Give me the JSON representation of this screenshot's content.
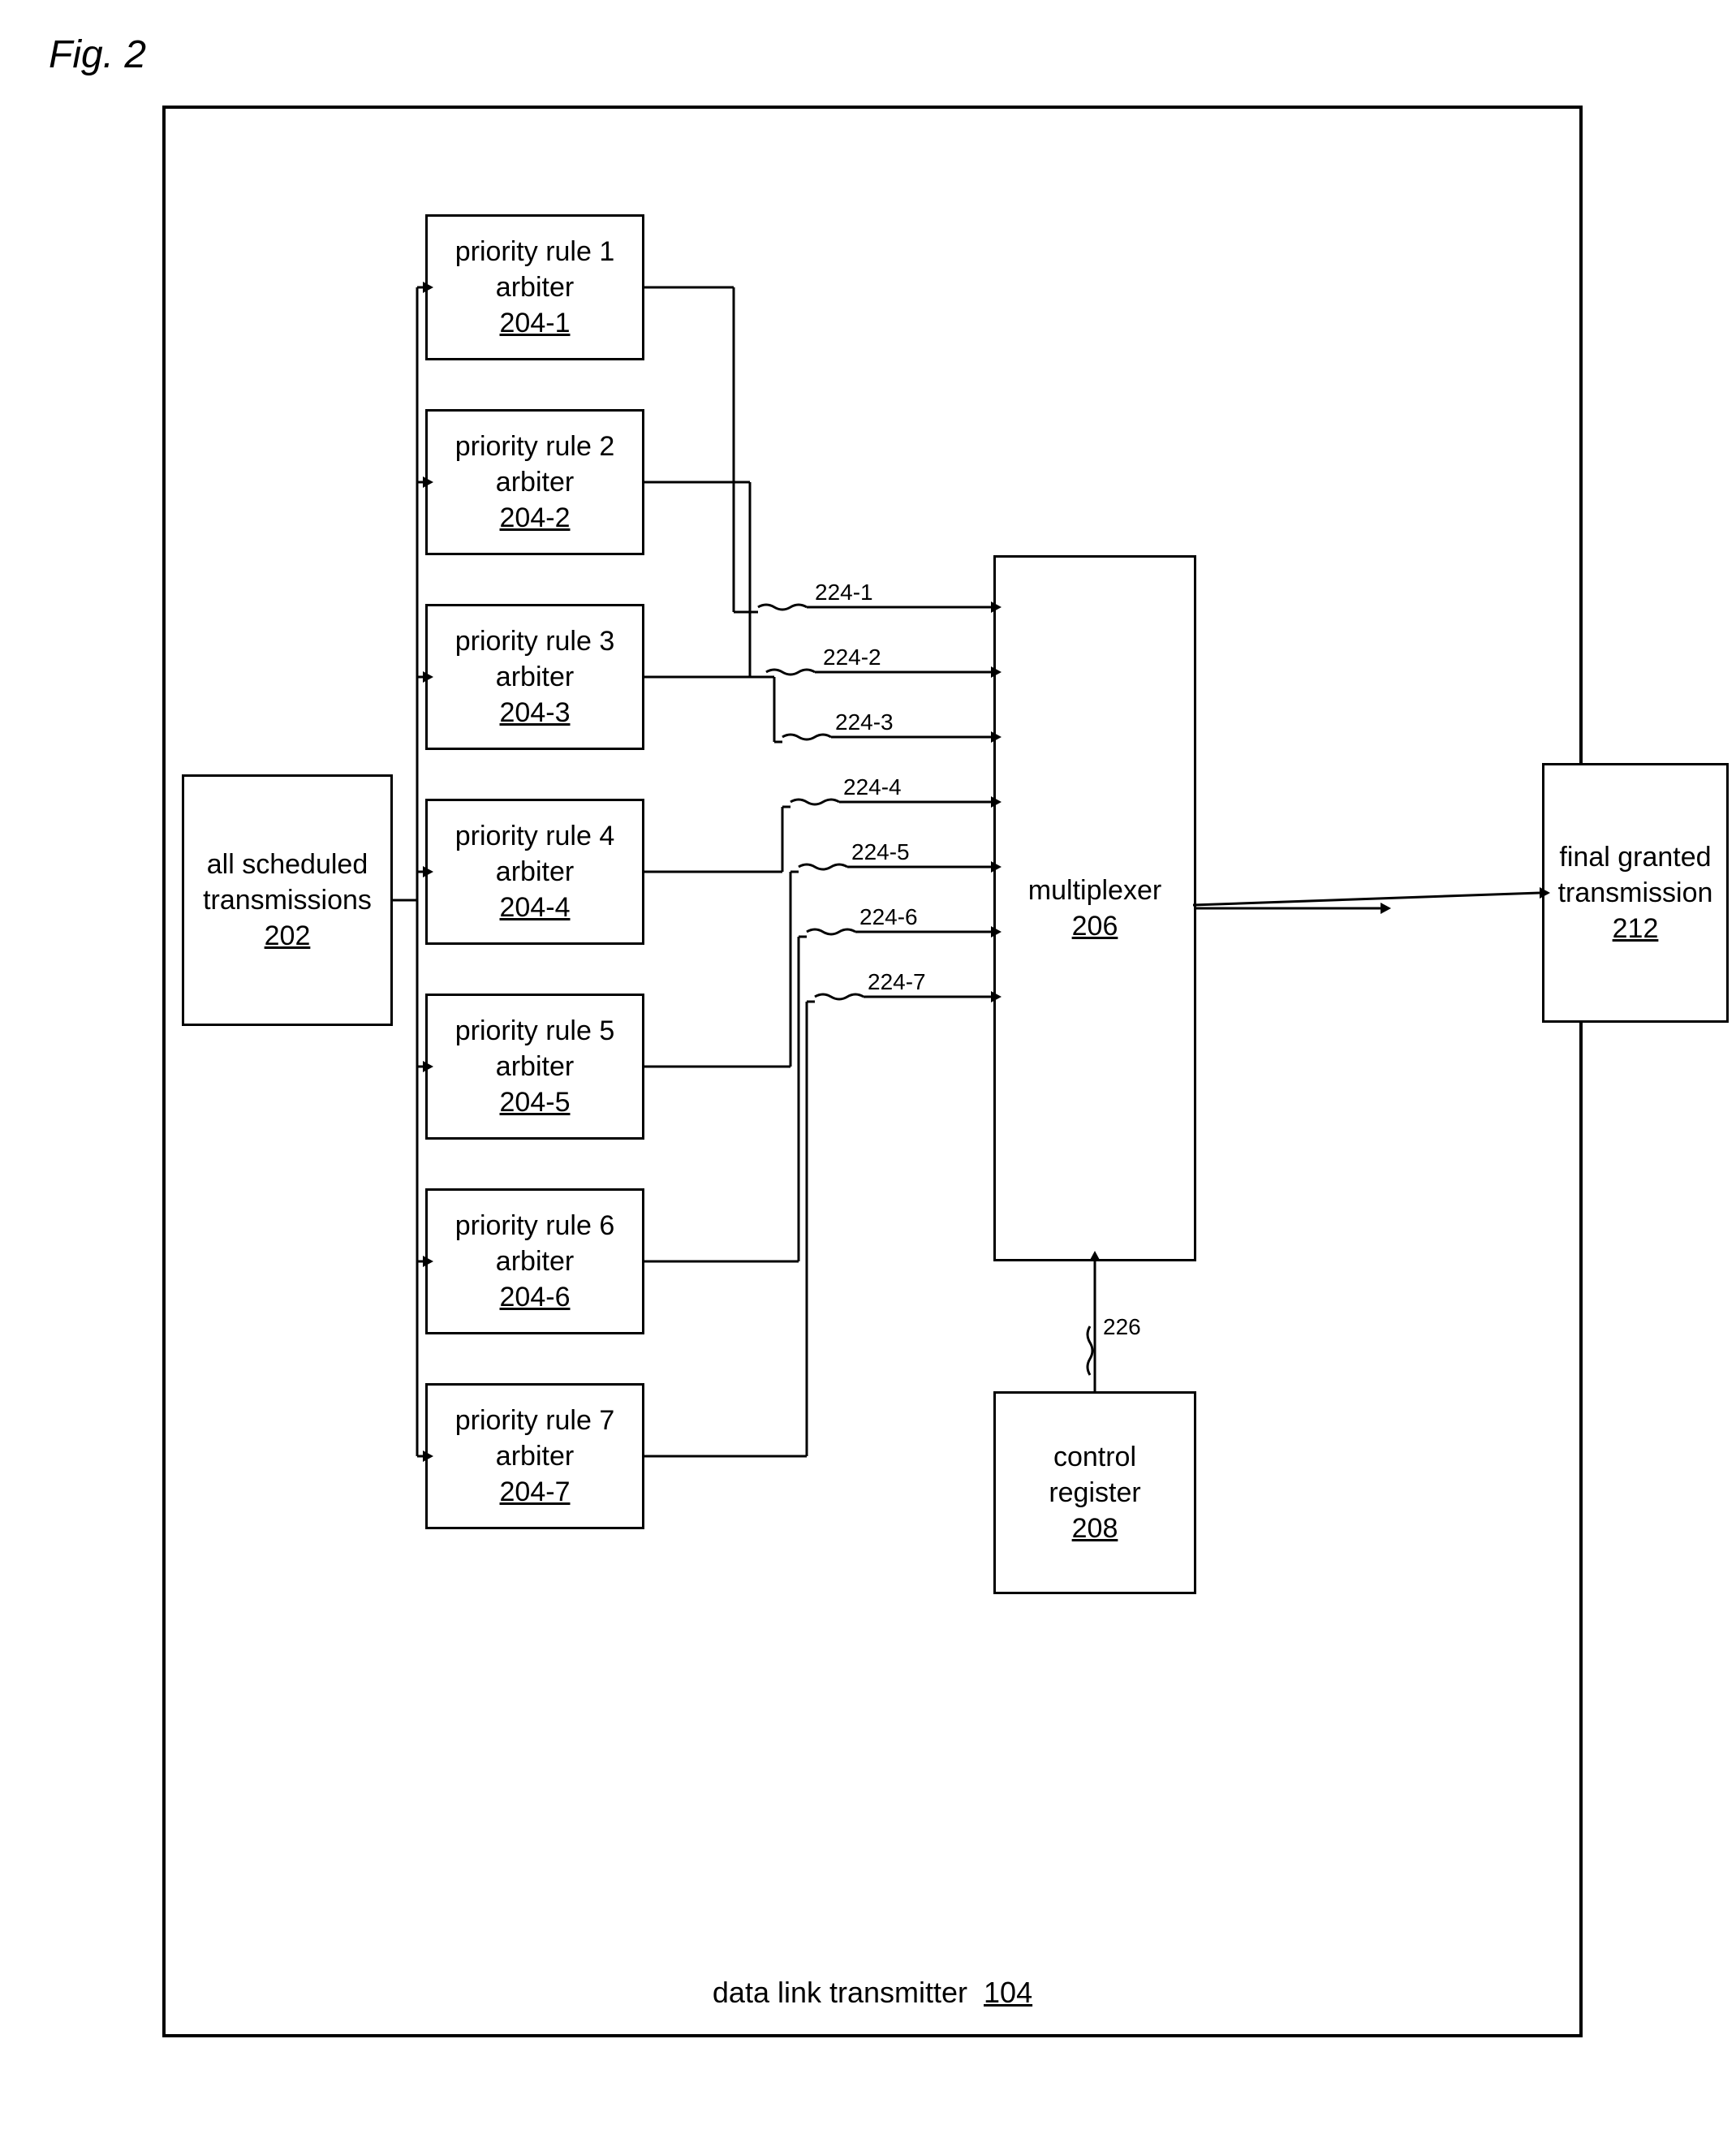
{
  "figure": {
    "label": "Fig. 2"
  },
  "boxes": {
    "all_scheduled": {
      "line1": "all scheduled",
      "line2": "transmissions",
      "ref": "202"
    },
    "arbiters": [
      {
        "label": "priority rule 1\narbiter",
        "ref": "204-1"
      },
      {
        "label": "priority rule 2\narbiter",
        "ref": "204-2"
      },
      {
        "label": "priority rule 3\narbiter",
        "ref": "204-3"
      },
      {
        "label": "priority rule 4\narbiter",
        "ref": "204-4"
      },
      {
        "label": "priority rule 5\narbiter",
        "ref": "204-5"
      },
      {
        "label": "priority rule 6\narbiter",
        "ref": "204-6"
      },
      {
        "label": "priority rule 7\narbiter",
        "ref": "204-7"
      }
    ],
    "multiplexer": {
      "line1": "multiplexer",
      "ref": "206"
    },
    "control_register": {
      "line1": "control",
      "line2": "register",
      "ref": "208"
    },
    "final_granted": {
      "line1": "final granted",
      "line2": "transmission",
      "ref": "212"
    },
    "data_link_transmitter": {
      "label": "data link transmitter",
      "ref": "104"
    }
  },
  "signals": [
    {
      "id": "224-1"
    },
    {
      "id": "224-2"
    },
    {
      "id": "224-3"
    },
    {
      "id": "224-4"
    },
    {
      "id": "224-5"
    },
    {
      "id": "224-6"
    },
    {
      "id": "224-7"
    }
  ],
  "signal_226": "226"
}
